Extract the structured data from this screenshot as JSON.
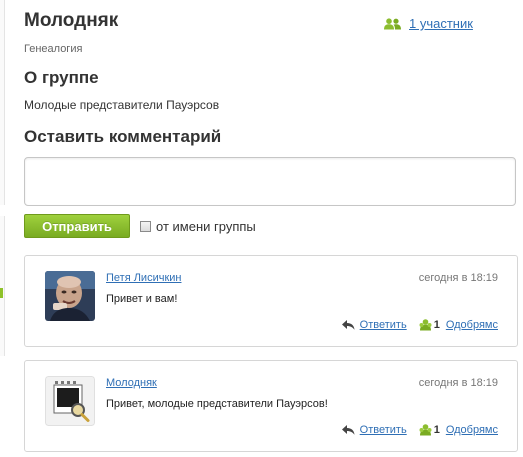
{
  "group": {
    "title": "Молодняк",
    "members_label": "1 участник",
    "category": "Генеалогия"
  },
  "about": {
    "heading": "О группе",
    "text": "Молодые представители Пауэрсов"
  },
  "comment_form": {
    "heading": "Оставить комментарий",
    "input_value": "",
    "send_label": "Отправить",
    "as_group_label": "от имени группы",
    "as_group_checked": false
  },
  "comments": [
    {
      "author": "Петя Лисичкин",
      "time": "сегодня в 18:19",
      "text": "Привет и вам!",
      "reply_label": "Ответить",
      "approve_count": "1",
      "approve_label": "Одобрямс"
    },
    {
      "author": "Молодняк",
      "time": "сегодня в 18:19",
      "text": "Привет, молодые представители Пауэрсов!",
      "reply_label": "Ответить",
      "approve_count": "1",
      "approve_label": "Одобрямс"
    }
  ],
  "colors": {
    "link": "#2f6fb5",
    "button_green": "#8bc02e",
    "icon_green": "#8cbd2f"
  },
  "icons": {
    "members": "users-icon",
    "reply": "reply-arrow-icon",
    "approve": "approve-icon",
    "group_avatar": "group-magnifier-icon"
  }
}
